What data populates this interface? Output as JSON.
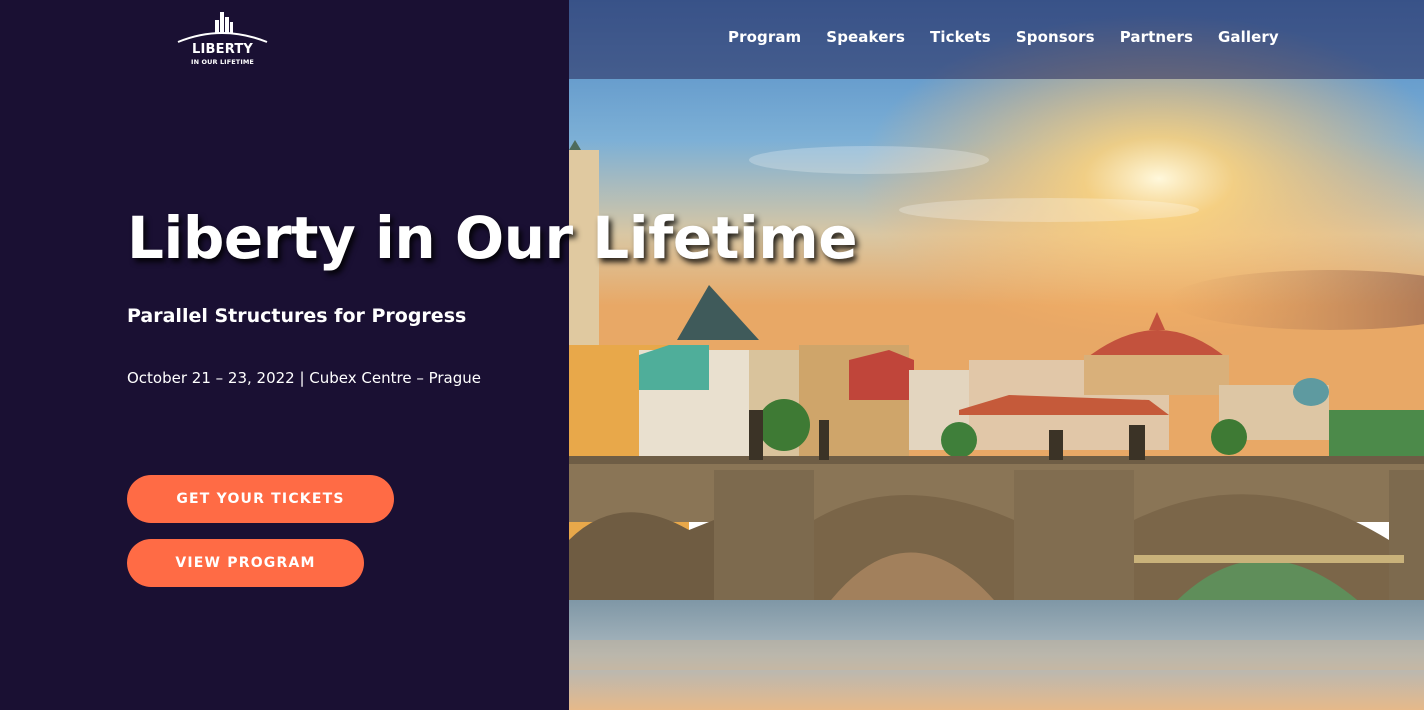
{
  "logo": {
    "main": "LIBERTY",
    "sub": "IN OUR LIFETIME"
  },
  "nav": {
    "items": [
      {
        "label": "Program"
      },
      {
        "label": "Speakers"
      },
      {
        "label": "Tickets"
      },
      {
        "label": "Sponsors"
      },
      {
        "label": "Partners"
      },
      {
        "label": "Gallery"
      }
    ]
  },
  "hero": {
    "title": "Liberty in Our Lifetime",
    "subtitle": "Parallel Structures for Progress",
    "date": "October 21 – 23, 2022 | Cubex Centre – Prague",
    "buttons": {
      "tickets": "GET YOUR TICKETS",
      "program": "VIEW PROGRAM"
    }
  },
  "colors": {
    "panel": "#1a1033",
    "accent": "#ff6b45",
    "text": "#ffffff"
  },
  "icons": {
    "logo": "city-skyline-icon"
  }
}
